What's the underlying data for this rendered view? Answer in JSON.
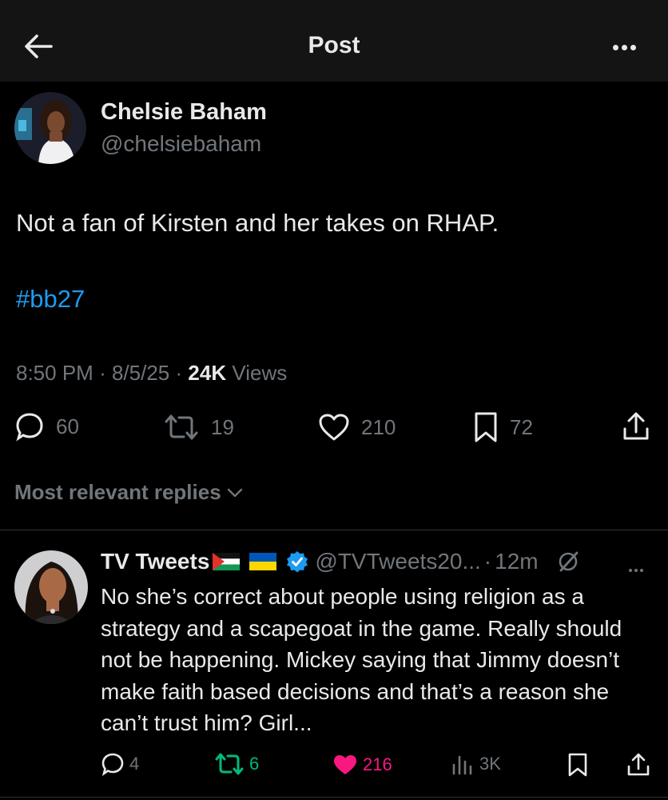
{
  "header": {
    "title": "Post"
  },
  "post": {
    "author_name": "Chelsie Baham",
    "author_handle": "@chelsiebaham",
    "text": "Not a fan of Kirsten and her takes on RHAP.",
    "hashtag": "#bb27",
    "time": "8:50 PM",
    "date": "8/5/25",
    "views_count": "24K",
    "views_label": "Views",
    "separator": "·",
    "actions": {
      "replies": "60",
      "reposts": "19",
      "likes": "210",
      "bookmarks": "72"
    }
  },
  "replies_section": {
    "sort_label": "Most relevant replies"
  },
  "reply": {
    "author_name": "TV Tweets",
    "author_handle": "@TVTweets20...",
    "time": "12m",
    "separator": "·",
    "text": "No she’s correct about people using religion as a strategy and a scapegoat in the game. Really should not be happening. Mickey saying that Jimmy doesn’t make faith based decisions and that’s a reason she can’t trust him? Girl...",
    "actions": {
      "replies": "4",
      "reposts": "6",
      "likes": "216",
      "views": "3K"
    }
  },
  "colors": {
    "background": "#000000",
    "header_bg": "#141414",
    "text_primary": "#e7e9ea",
    "text_secondary": "#71767b",
    "link_blue": "#1d9bf0",
    "like_pink": "#f91880",
    "repost_green": "#00ba7c",
    "verified_blue": "#1d9bf0"
  }
}
